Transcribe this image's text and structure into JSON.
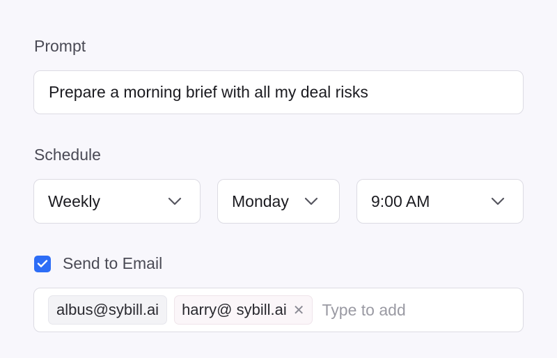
{
  "prompt": {
    "label": "Prompt",
    "value": "Prepare a morning brief with all my deal risks"
  },
  "schedule": {
    "label": "Schedule",
    "frequency": "Weekly",
    "day": "Monday",
    "time": "9:00 AM"
  },
  "email": {
    "checkbox_label": "Send to Email",
    "checked": true,
    "recipients": [
      "albus@sybill.ai",
      "harry@ sybill.ai"
    ],
    "placeholder": "Type to add"
  },
  "colors": {
    "accent": "#2d6df6",
    "background": "#f8f7fc",
    "border": "#dcdbe3"
  }
}
